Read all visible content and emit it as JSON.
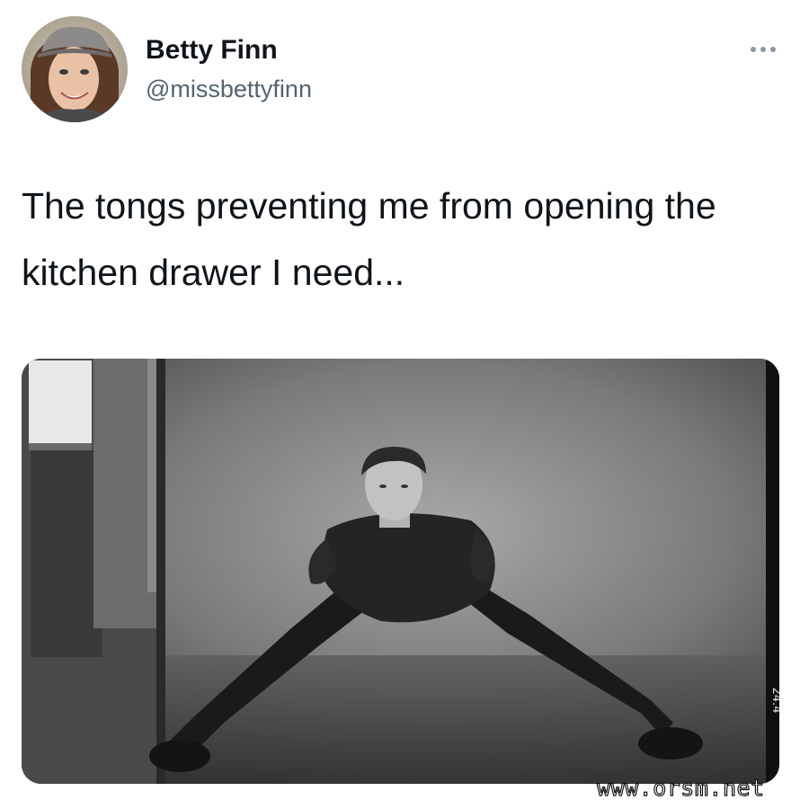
{
  "tweet": {
    "author": {
      "display_name": "Betty Finn",
      "handle": "@missbettyfinn"
    },
    "text": "The tongs preventing me from opening the kitchen drawer I need...",
    "more_icon": "more-dots-icon"
  },
  "media": {
    "frame_label": "24.4"
  },
  "watermark": "www.orsm.net"
}
